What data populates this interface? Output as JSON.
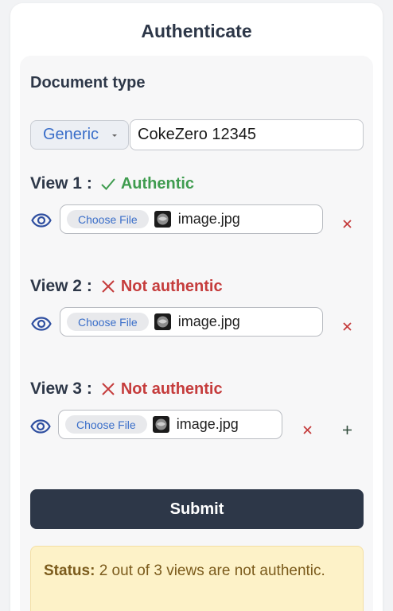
{
  "header": {
    "title": "Authenticate"
  },
  "document": {
    "section_label": "Document type",
    "type_select": {
      "selected": "Generic"
    },
    "id_value": "CokeZero 12345"
  },
  "views": [
    {
      "label": "View 1 :",
      "status": "Authentic",
      "authentic": true,
      "choose_label": "Choose File",
      "file_name": "image.jpg"
    },
    {
      "label": "View 2 :",
      "status": "Not authentic",
      "authentic": false,
      "choose_label": "Choose File",
      "file_name": "image.jpg"
    },
    {
      "label": "View 3 :",
      "status": "Not authentic",
      "authentic": false,
      "choose_label": "Choose File",
      "file_name": "image.jpg"
    }
  ],
  "actions": {
    "submit_label": "Submit"
  },
  "status": {
    "label": "Status:",
    "message": "2 out of 3 views are not authentic."
  },
  "colors": {
    "accent": "#2d3748",
    "ok": "#3f9c4f",
    "bad": "#c53c3c",
    "link": "#3a6ec9",
    "warning_bg": "#fdf2c8"
  }
}
